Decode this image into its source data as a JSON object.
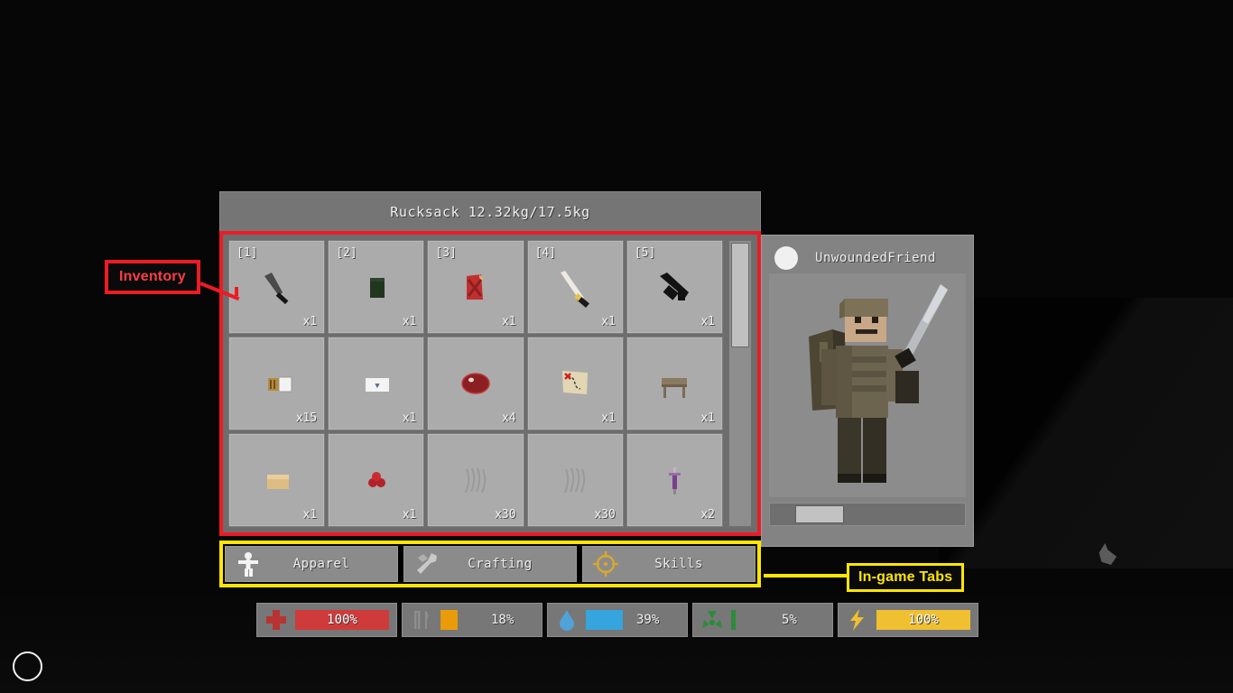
{
  "window": {
    "title": "Rucksack  12.32kg/17.5kg",
    "container_name": "Rucksack",
    "weight_current": "12.32kg",
    "weight_max": "17.5kg"
  },
  "inventory": {
    "columns": 5,
    "rows": 3,
    "scroll_position": "top",
    "slots": [
      {
        "key": "[1]",
        "qty": "x1",
        "item": "combat-knife-icon",
        "art": "knife"
      },
      {
        "key": "[2]",
        "qty": "x1",
        "item": "green-crate-icon",
        "art": "greenbox"
      },
      {
        "key": "[3]",
        "qty": "x1",
        "item": "red-jerrycan-icon",
        "art": "jerrycan"
      },
      {
        "key": "[4]",
        "qty": "x1",
        "item": "machete-icon",
        "art": "machete"
      },
      {
        "key": "[5]",
        "qty": "x1",
        "item": "assault-rifle-icon",
        "art": "rifle"
      },
      {
        "key": "",
        "qty": "x15",
        "item": "ammo-box-icon",
        "art": "ammo"
      },
      {
        "key": "",
        "qty": "x1",
        "item": "white-sign-icon",
        "art": "sign"
      },
      {
        "key": "",
        "qty": "x4",
        "item": "raw-meat-icon",
        "art": "meat"
      },
      {
        "key": "",
        "qty": "x1",
        "item": "treasure-map-icon",
        "art": "map"
      },
      {
        "key": "",
        "qty": "x1",
        "item": "wooden-table-icon",
        "art": "table"
      },
      {
        "key": "",
        "qty": "x1",
        "item": "cardboard-box-icon",
        "art": "box"
      },
      {
        "key": "",
        "qty": "x1",
        "item": "berries-icon",
        "art": "berries"
      },
      {
        "key": "",
        "qty": "x30",
        "item": "metal-scrap-icon",
        "art": "scrap"
      },
      {
        "key": "",
        "qty": "x30",
        "item": "metal-scrap-icon",
        "art": "scrap"
      },
      {
        "key": "",
        "qty": "x2",
        "item": "syringe-icon",
        "art": "syringe"
      }
    ]
  },
  "tabs": [
    {
      "label": "Apparel",
      "icon": "person-icon",
      "active": false
    },
    {
      "label": "Crafting",
      "icon": "wrench-icon",
      "active": false
    },
    {
      "label": "Skills",
      "icon": "crosshair-icon",
      "active": false
    }
  ],
  "character": {
    "player_name": "UnwoundedFriend",
    "avatar": "circle-avatar-icon",
    "equipped": "machete",
    "zoom_slider_value": "low"
  },
  "status": [
    {
      "name": "health",
      "icon": "medical-cross-icon",
      "value": "100%",
      "percent": 100,
      "color": "#cf3b3b",
      "label_inside": true
    },
    {
      "name": "food",
      "icon": "utensils-icon",
      "value": "18%",
      "percent": 18,
      "color": "#e99b09",
      "label_inside": false
    },
    {
      "name": "water",
      "icon": "water-drop-icon",
      "value": "39%",
      "percent": 39,
      "color": "#36a4dd",
      "label_inside": false
    },
    {
      "name": "radiation",
      "icon": "radiation-icon",
      "value": "5%",
      "percent": 5,
      "color": "#2e8a3c",
      "label_inside": false
    },
    {
      "name": "stamina",
      "icon": "lightning-icon",
      "value": "100%",
      "percent": 100,
      "color": "#f0c030",
      "label_inside": true
    }
  ],
  "annotations": [
    {
      "id": "inventory",
      "text": "Inventory",
      "color": "#ed1b24"
    },
    {
      "id": "in-game-tabs",
      "text": "In-game Tabs",
      "color": "#ffe600"
    }
  ],
  "cursor": {
    "name": "circle-crosshair-icon"
  }
}
